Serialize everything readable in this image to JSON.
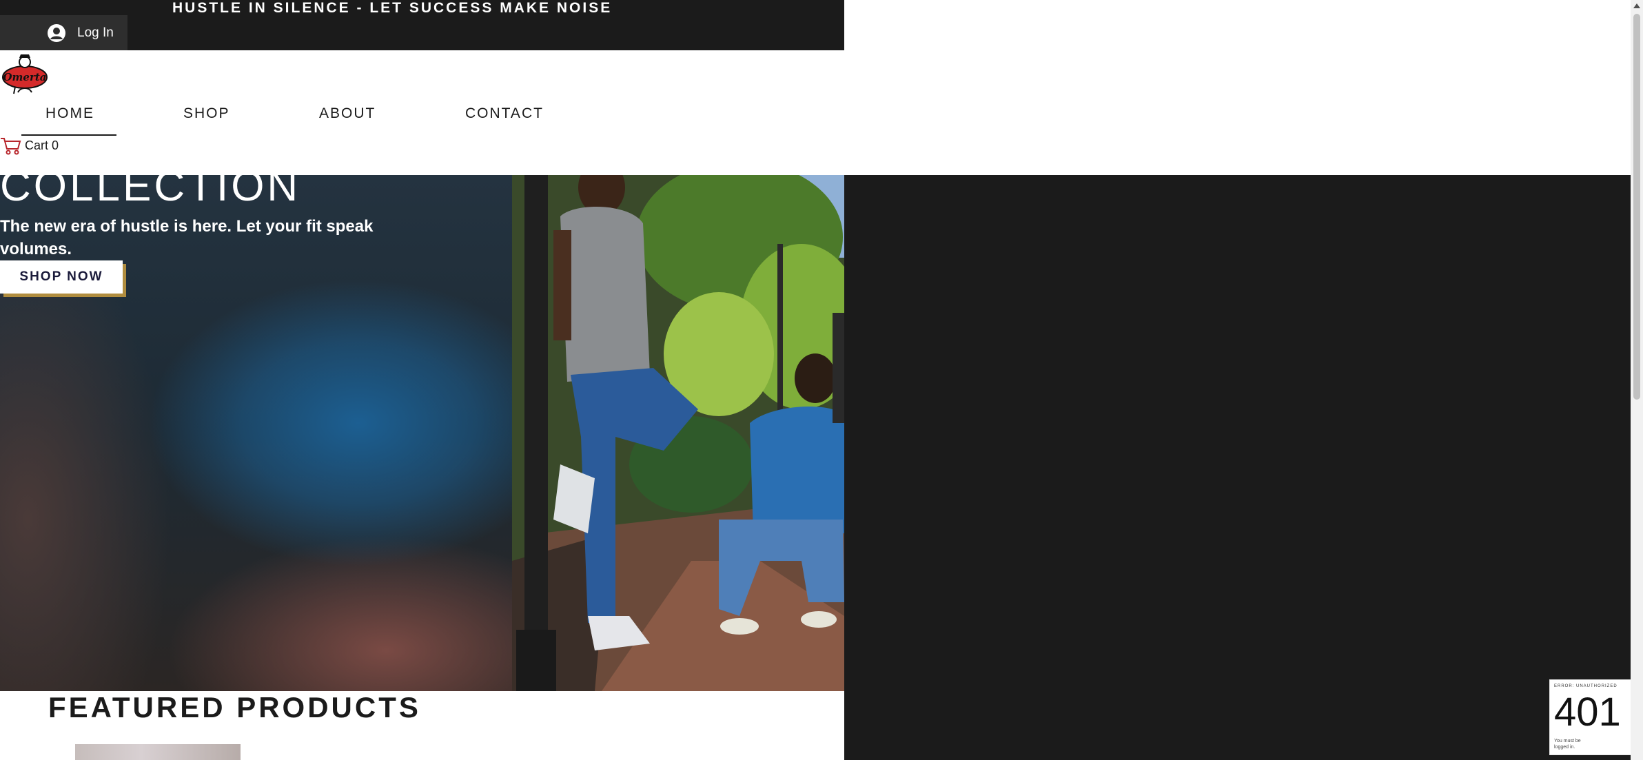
{
  "topbar": {
    "announcement": "HUSTLE IN SILENCE - LET SUCCESS MAKE NOISE",
    "login_label": "Log In"
  },
  "logo": {
    "text": "Omerta"
  },
  "nav": {
    "items": [
      {
        "label": "HOME",
        "active": true
      },
      {
        "label": "SHOP"
      },
      {
        "label": "ABOUT"
      },
      {
        "label": "CONTACT"
      }
    ]
  },
  "cart": {
    "label": "Cart 0"
  },
  "hero": {
    "title": "COLLECTION",
    "subtitle": "The new era of hustle is here. Let your fit speak volumes.",
    "cta_label": "SHOP NOW"
  },
  "featured": {
    "title": "FEATURED PRODUCTS"
  },
  "error_badge": {
    "label": "ERROR: UNAUTHORIZED",
    "code": "401",
    "message": "You must be logged in."
  },
  "colors": {
    "dark": "#1b1b1b",
    "cta_shadow": "#b08d3f",
    "logo_red": "#d42a2a"
  },
  "icons": {
    "login": "user-circle-icon",
    "cart": "cart-icon"
  }
}
